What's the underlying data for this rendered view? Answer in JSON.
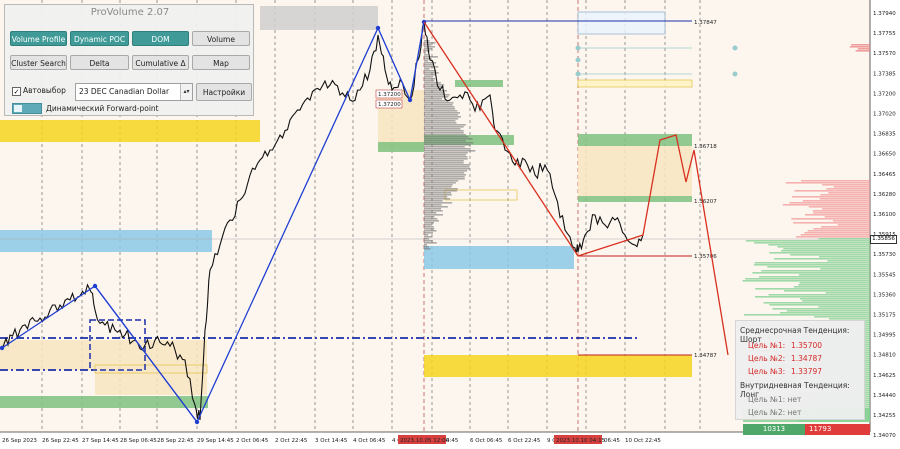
{
  "panel": {
    "title": "ProVolume 2.07",
    "buttons_row1": [
      "Volume Profile",
      "Dynamic POC",
      "DOM",
      "Volume"
    ],
    "buttons_row2": [
      "Cluster Search",
      "Delta",
      "Cumulative Δ",
      "Map"
    ],
    "auto_label": "Автовыбор",
    "auto_checked": "✓",
    "symbol": "23 DEC Canadian Dollar",
    "settings": "Настройки",
    "forward_point": "Динамический Forward-point"
  },
  "x_axis": [
    "26 Sep 2023",
    "26 Sep 22:45",
    "27 Sep 14:45",
    "28 Sep 06:45",
    "28 Sep 22:45",
    "29 Sep 14:45",
    "2 Oct 06:45",
    "2 Oct 22:45",
    "3 Oct 14:45",
    "4 Oct 06:45",
    "4 Oct",
    "2023.10.05 12:00",
    "4:45",
    "6 Oct 06:45",
    "6 Oct 22:45",
    "9 Oct",
    "2023.10.10 04:15",
    "06:45",
    "10 Oct 22:45"
  ],
  "y_axis": [
    "1.37940",
    "1.37755",
    "1.37570",
    "1.37385",
    "1.37200",
    "1.37020",
    "1.36835",
    "1.36650",
    "1.36465",
    "1.36280",
    "1.36100",
    "1.35915",
    "1.35730",
    "1.35545",
    "1.35360",
    "1.35175",
    "1.34995",
    "1.34810",
    "1.34625",
    "1.34440",
    "1.34255",
    "1.34070"
  ],
  "current_price": "1.35856",
  "levels": {
    "l1": "1.37847",
    "l2": "1.36718",
    "l3": "1.36207",
    "l4": "1.35706",
    "l5": "1.34787",
    "pl1": "1.37200",
    "pl2": "1.37200"
  },
  "info": {
    "mid_title": "Среднесрочная Тенденция: Шорт",
    "t1_label": "Цель №1:",
    "t1_value": "1.35700",
    "t2_label": "Цель №2:",
    "t2_value": "1.34787",
    "t3_label": "Цель №3:",
    "t3_value": "1.33797",
    "intra_title": "Внутридневная Тенденция: Лонг",
    "i1": "Цель №1: нет",
    "i2": "Цель №2: нет"
  },
  "volume": {
    "left": "10313",
    "right": "11793"
  },
  "colors": {
    "buy": "#4fa86a",
    "sell": "#e03c3c",
    "accent": "#3f9a98",
    "zone_yellow": "#f6d51e",
    "zone_blue": "#8ac9e6",
    "zone_green": "#7fc17f",
    "wave_blue": "#1f3fd3",
    "wave_red": "#d83020"
  }
}
